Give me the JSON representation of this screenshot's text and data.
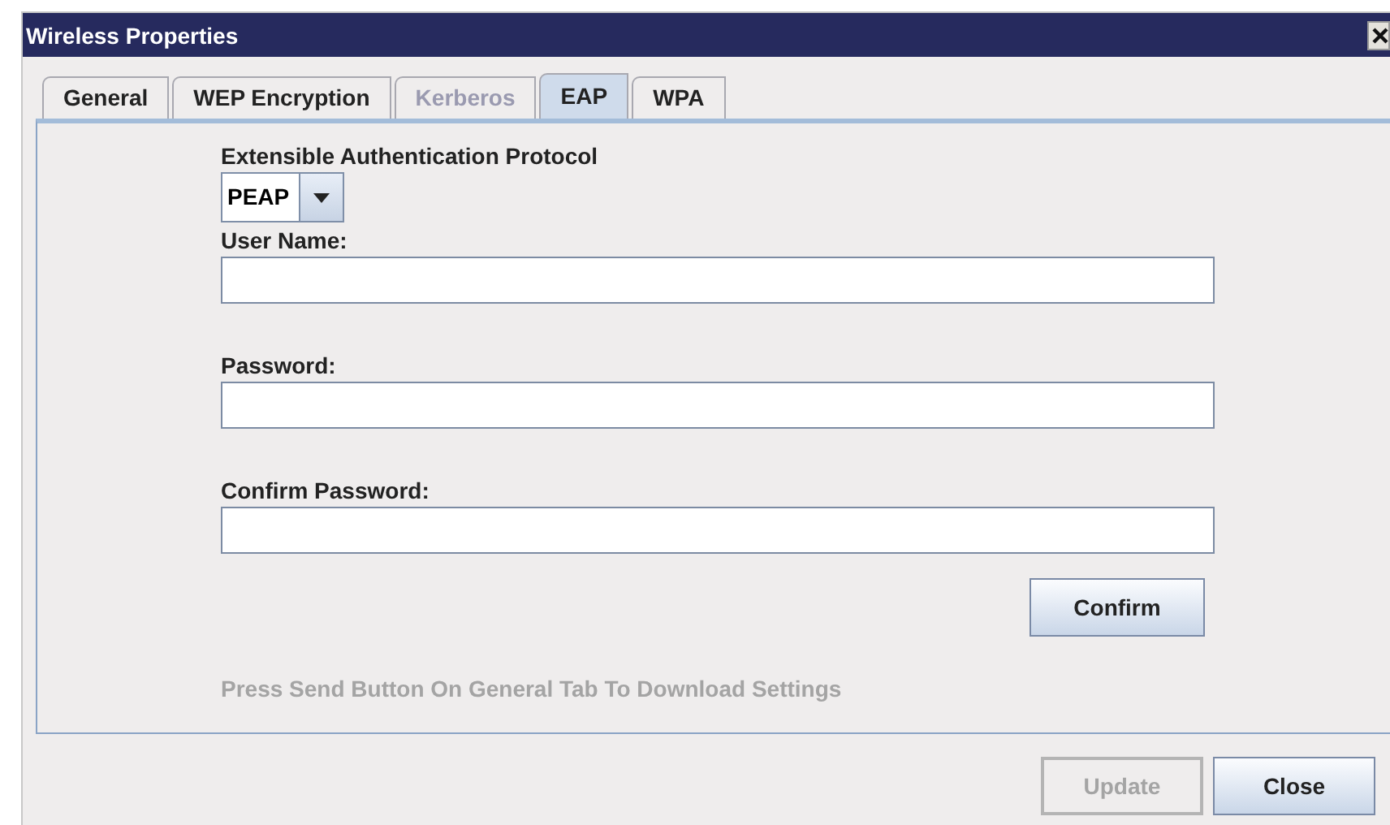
{
  "window": {
    "title": "Wireless Properties"
  },
  "tabs": [
    {
      "label": "General",
      "selected": false,
      "disabled": false
    },
    {
      "label": "WEP Encryption",
      "selected": false,
      "disabled": false
    },
    {
      "label": "Kerberos",
      "selected": false,
      "disabled": true
    },
    {
      "label": "EAP",
      "selected": true,
      "disabled": false
    },
    {
      "label": "WPA",
      "selected": false,
      "disabled": false
    }
  ],
  "protocol": {
    "label": "Extensible Authentication Protocol",
    "value": "PEAP"
  },
  "fields": [
    {
      "label": "User Name:"
    },
    {
      "label": "Password:"
    },
    {
      "label": "Confirm Password:"
    }
  ],
  "confirm_button": {
    "label": "Confirm"
  },
  "hint": "Press Send Button On General Tab To Download Settings",
  "buttons": [
    {
      "label": "Update",
      "disabled": true
    },
    {
      "label": "Close",
      "disabled": false
    }
  ]
}
